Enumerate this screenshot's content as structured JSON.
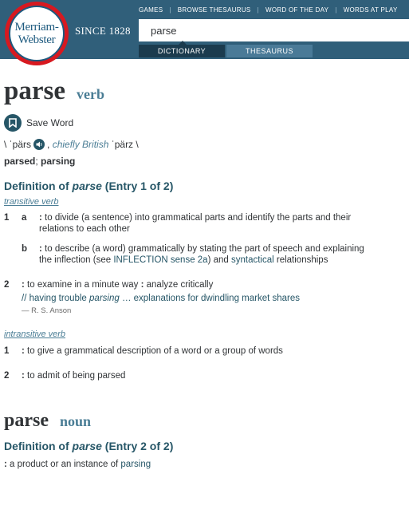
{
  "header": {
    "logo_line1": "Merriam-",
    "logo_line2": "Webster",
    "since": "SINCE 1828",
    "nav": [
      "GAMES",
      "BROWSE THESAURUS",
      "WORD OF THE DAY",
      "WORDS AT PLAY"
    ],
    "search_value": "parse",
    "tab_dictionary": "DICTIONARY",
    "tab_thesaurus": "THESAURUS"
  },
  "entry1": {
    "headword": "parse",
    "pos": "verb",
    "save_label": "Save Word",
    "pron_open": "\\ ˈpärs",
    "pron_chiefly": "chiefly British",
    "pron_british": "ˈpärz \\",
    "inflection_1": "parsed",
    "inflection_sep": "; ",
    "inflection_2": "parsing",
    "def_heading_pre": "Definition of ",
    "def_heading_word": "parse",
    "def_heading_post": " (Entry 1 of 2)",
    "transitive_label": "transitive verb",
    "s1_num": "1",
    "s1a_letter": "a",
    "s1a_text": " to divide (a sentence) into grammatical parts and identify the parts and their relations to each other",
    "s1b_letter": "b",
    "s1b_text_1": " to describe (a word) grammatically by stating the part of speech and explaining the inflection (see ",
    "s1b_link_1": "INFLECTION sense 2a",
    "s1b_text_2": ") and ",
    "s1b_link_2": "syntactical",
    "s1b_text_3": " relationships",
    "s2_num": "2",
    "s2_text_1": " to examine in a minute way ",
    "s2_text_2": " analyze critically",
    "s2_example_pre": "// having trouble ",
    "s2_example_word": "parsing",
    "s2_example_post": " … explanations for dwindling market shares",
    "s2_attribution": "— R. S. Anson",
    "intransitive_label": "intransitive verb",
    "i1_num": "1",
    "i1_text": " to give a grammatical description of a word or a group of words",
    "i2_num": "2",
    "i2_text": " to admit of being parsed"
  },
  "entry2": {
    "headword": "parse",
    "pos": "noun",
    "def_heading_pre": "Definition of ",
    "def_heading_word": "parse",
    "def_heading_post": " (Entry 2 of 2)",
    "def_text": " a product or an instance of ",
    "def_link": "parsing"
  },
  "icons": {
    "logo": "merriam-webster-logo",
    "save": "bookmark-icon",
    "audio": "speaker-icon"
  },
  "colors": {
    "header_bg": "#305f7a",
    "logo_red": "#d71920",
    "accent": "#265667",
    "pos_color": "#4a7d95"
  }
}
